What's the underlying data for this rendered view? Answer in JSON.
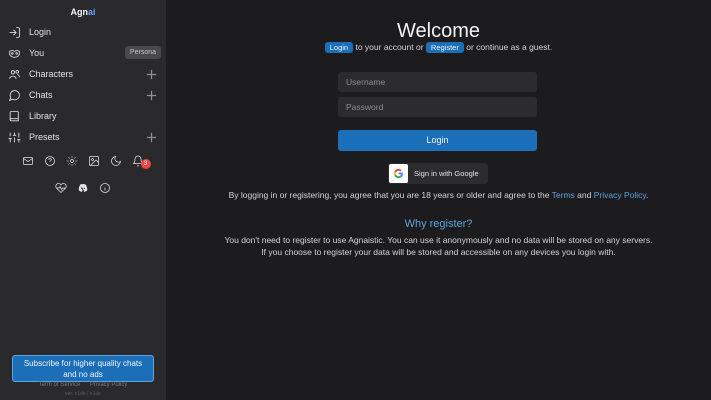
{
  "brand": {
    "prefix": "Agn",
    "suffix": "ai"
  },
  "sidebar": {
    "items": [
      {
        "label": "Login",
        "icon": "log-in-icon"
      },
      {
        "label": "You",
        "icon": "mask-icon",
        "badge": "Persona"
      },
      {
        "label": "Characters",
        "icon": "characters-icon"
      },
      {
        "label": "Chats",
        "icon": "chat-icon"
      },
      {
        "label": "Library",
        "icon": "book-icon"
      },
      {
        "label": "Presets",
        "icon": "sliders-icon"
      }
    ],
    "notification_count": "3",
    "subscribe_label": "Subscribe for higher quality chats and no ads",
    "footer": {
      "terms": "Term of Service",
      "privacy": "Privacy Policy"
    },
    "version": "ver. e1de / e1de"
  },
  "main": {
    "title": "Welcome",
    "login_pill": "Login",
    "to_account": "to your account or",
    "register_pill": "Register",
    "guest": "or continue as a guest.",
    "username_placeholder": "Username",
    "password_placeholder": "Password",
    "login_button": "Login",
    "google_label": "Sign in with Google",
    "terms_prefix": "By logging in or registering, you agree that you are 18 years or older and agree to the",
    "terms_link": "Terms",
    "terms_and": "and",
    "privacy_link": "Privacy Policy",
    "terms_end": ".",
    "why_title": "Why register?",
    "why_line1": "You don't need to register to use Agnaistic. You can use it anonymously and no data will be stored on any servers.",
    "why_line2": "If you choose to register your data will be stored and accessible on any devices you login with."
  },
  "colors": {
    "accent": "#1b6fb8",
    "link": "#5ea3e0",
    "sidebar_bg": "#2a2a2d",
    "main_bg": "#1c1c1e",
    "badge": "#ef4444"
  }
}
